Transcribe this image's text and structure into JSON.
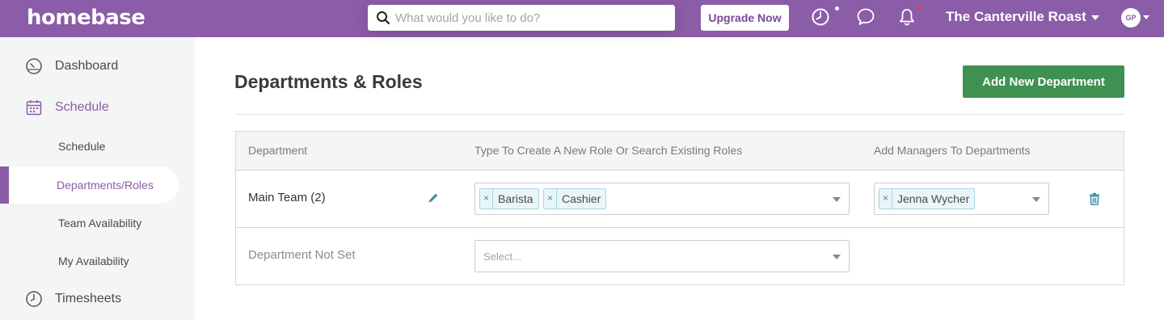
{
  "header": {
    "logo": "homebase",
    "search": {
      "placeholder": "What would you like to do?",
      "value": ""
    },
    "upgrade_label": "Upgrade Now",
    "location": "The Canterville Roast",
    "avatar_initials": "GP",
    "icons": [
      "clock-icon",
      "chat-icon",
      "bell-icon"
    ],
    "notification_dot_color": "#e04545"
  },
  "sidebar": {
    "main_items": [
      {
        "label": "Dashboard",
        "icon": "dashboard-icon"
      },
      {
        "label": "Schedule",
        "icon": "calendar-icon"
      },
      {
        "label": "Timesheets",
        "icon": "clock-icon"
      }
    ],
    "sub_items": [
      {
        "label": "Schedule"
      },
      {
        "label": "Departments/Roles",
        "active": true
      },
      {
        "label": "Team Availability"
      },
      {
        "label": "My Availability"
      }
    ]
  },
  "main": {
    "title": "Departments & Roles",
    "add_button_label": "Add New Department",
    "table": {
      "headers": [
        "Department",
        "Type To Create A New Role Or Search Existing Roles",
        "Add Managers To Departments"
      ],
      "rows": [
        {
          "name": "Main Team (2)",
          "roles": [
            {
              "label": "Barista",
              "remove": "×"
            },
            {
              "label": "Cashier",
              "remove": "×"
            }
          ],
          "managers": [
            {
              "label": "Jenna Wycher",
              "remove": "×"
            }
          ]
        },
        {
          "name": "Department Not Set",
          "roles_placeholder": "Select..."
        }
      ]
    }
  },
  "colors": {
    "brand_purple": "#8b5ca8",
    "add_button_green": "#3f9152",
    "tag_blue": "#3d8ea6"
  }
}
